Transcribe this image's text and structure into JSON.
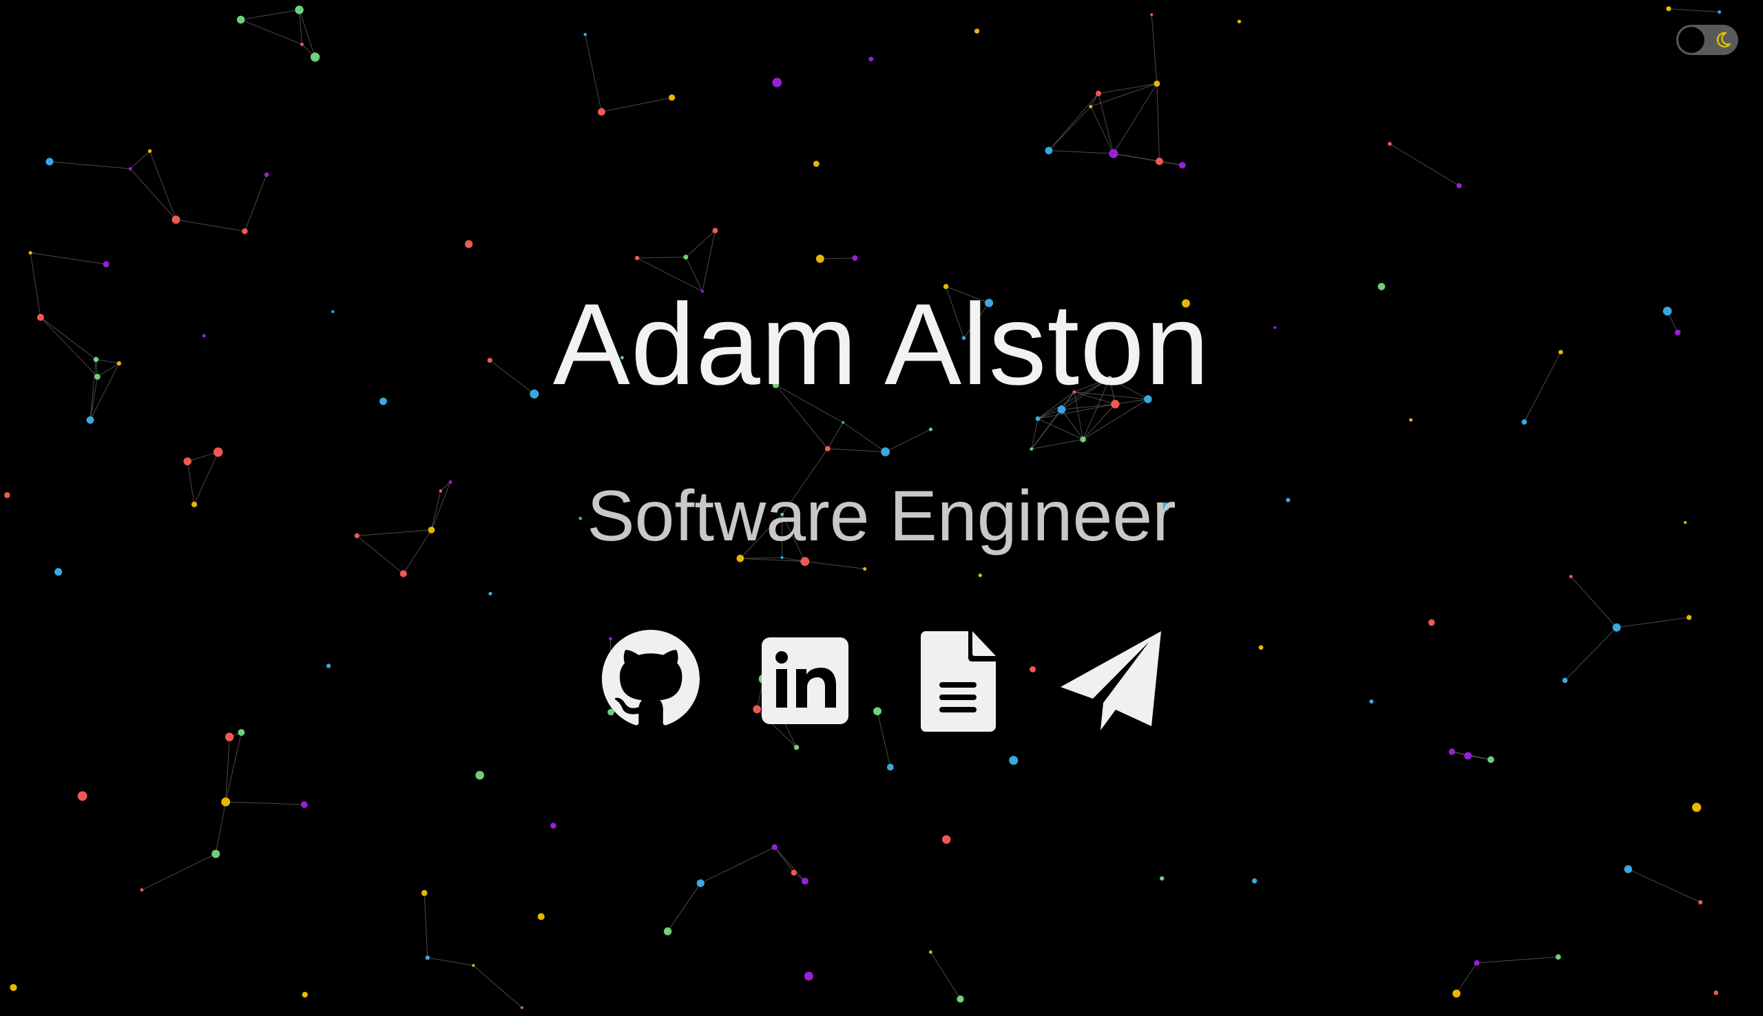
{
  "header": {
    "name": "Adam Alston",
    "role": "Software Engineer"
  },
  "theme_toggle": {
    "icon": "moon-icon",
    "state": "dark"
  },
  "social_links": [
    {
      "icon": "github-icon"
    },
    {
      "icon": "linkedin-icon"
    },
    {
      "icon": "resume-document-icon"
    },
    {
      "icon": "paper-plane-icon"
    }
  ],
  "colors": {
    "background": "#000000",
    "name_text": "#f2f2f2",
    "role_text": "#c8c8c8",
    "icon_fill": "#f0f0f0",
    "toggle_track": "#5a5a5a",
    "toggle_moon": "#e6c200",
    "particles": [
      "#ee5a52",
      "#e8b800",
      "#9b1fd6",
      "#3aa8e0",
      "#6fd07a"
    ]
  }
}
